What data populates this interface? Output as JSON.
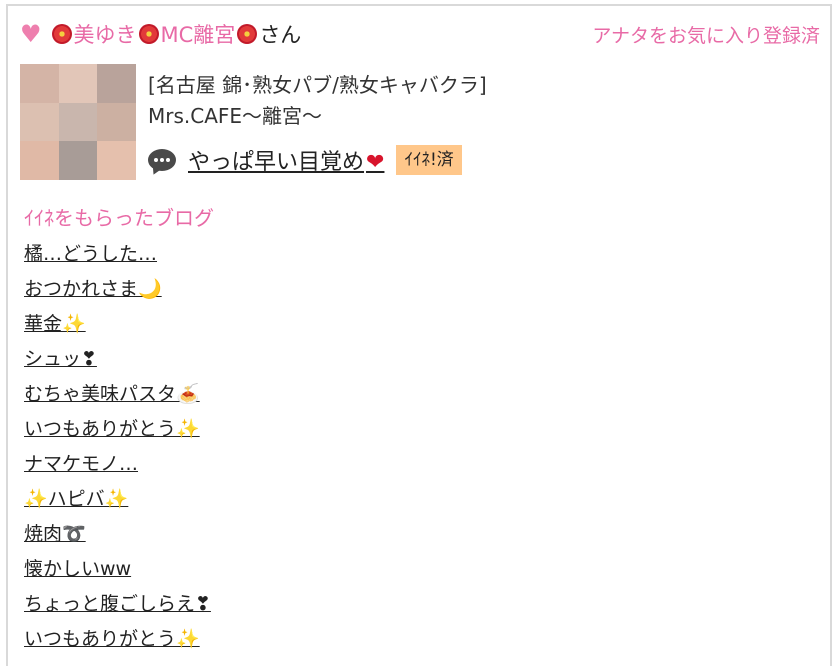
{
  "header": {
    "name_part1": "美ゆき",
    "name_part2": "MC離宮",
    "name_suffix": "さん",
    "favorite_link": "アナタをお気に入り登録済"
  },
  "profile": {
    "shop_line1": "[名古屋 錦･熟女パブ/熟女キャバクラ]",
    "shop_line2": "Mrs.CAFE〜離宮〜",
    "latest_post": "やっぱ早い目覚め",
    "latest_post_emoji": "❤",
    "iine_badge": "ｲｲﾈ!済"
  },
  "section_title": "ｲｲﾈをもらったブログ",
  "blogs": [
    "橘…どうした…",
    "おつかれさま🌙",
    "華金✨",
    "シュッ❣",
    "むちゃ美味パスタ🍝",
    "いつもありがとう✨",
    "ナマケモノ…",
    "✨ハピバ✨",
    "焼肉➰",
    "懐かしいww",
    "ちょっと腹ごしらえ❣",
    "いつもありがとう✨"
  ],
  "colors": {
    "accent_pink": "#e86aa6",
    "badge_bg": "#ffc78a"
  },
  "icons": [
    "heart-icon",
    "hibiscus-icon",
    "speech-bubble-icon",
    "red-heart-icon",
    "profile-thumbnail"
  ]
}
